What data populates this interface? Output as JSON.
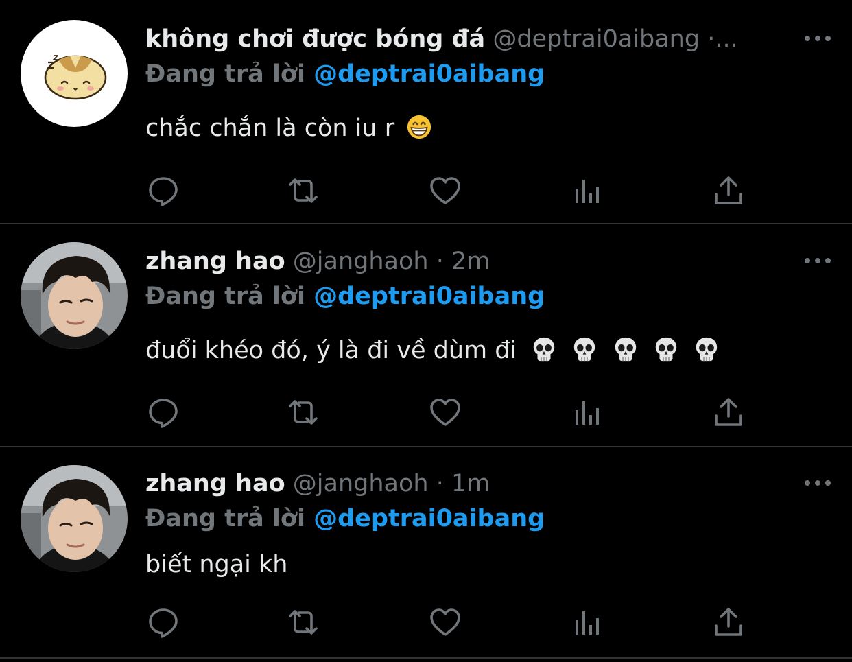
{
  "tweets": [
    {
      "display_name": "không chơi được bóng đá",
      "handle": "@deptrai0aibang",
      "dot": "·",
      "time": "...",
      "replying_prefix": "Đang trả lời",
      "replying_handle": "@deptrai0aibang",
      "text": "chắc chắn là còn iu r",
      "emoji": [
        "grinning-face-emoji"
      ],
      "avatar": "hamster-cartoon-avatar"
    },
    {
      "display_name": "zhang hao",
      "handle": "@janghaoh",
      "dot": "·",
      "time": "2m",
      "replying_prefix": "Đang trả lời",
      "replying_handle": "@deptrai0aibang",
      "text": "đuổi khéo đó, ý là đi về dùm đi",
      "emoji": [
        "skull-emoji",
        "skull-emoji",
        "skull-emoji",
        "skull-emoji",
        "skull-emoji"
      ],
      "avatar": "user-photo-avatar"
    },
    {
      "display_name": "zhang hao",
      "handle": "@janghaoh",
      "dot": "·",
      "time": "1m",
      "replying_prefix": "Đang trả lời",
      "replying_handle": "@deptrai0aibang",
      "text": "biết ngại kh",
      "emoji": [],
      "avatar": "user-photo-avatar"
    }
  ],
  "actions": [
    "reply-icon",
    "retweet-icon",
    "like-icon",
    "analytics-icon",
    "share-icon"
  ],
  "colors": {
    "background": "#000000",
    "text": "#e7e9ea",
    "muted": "#71767b",
    "link": "#1d9bf0",
    "divider": "#2f3336"
  }
}
